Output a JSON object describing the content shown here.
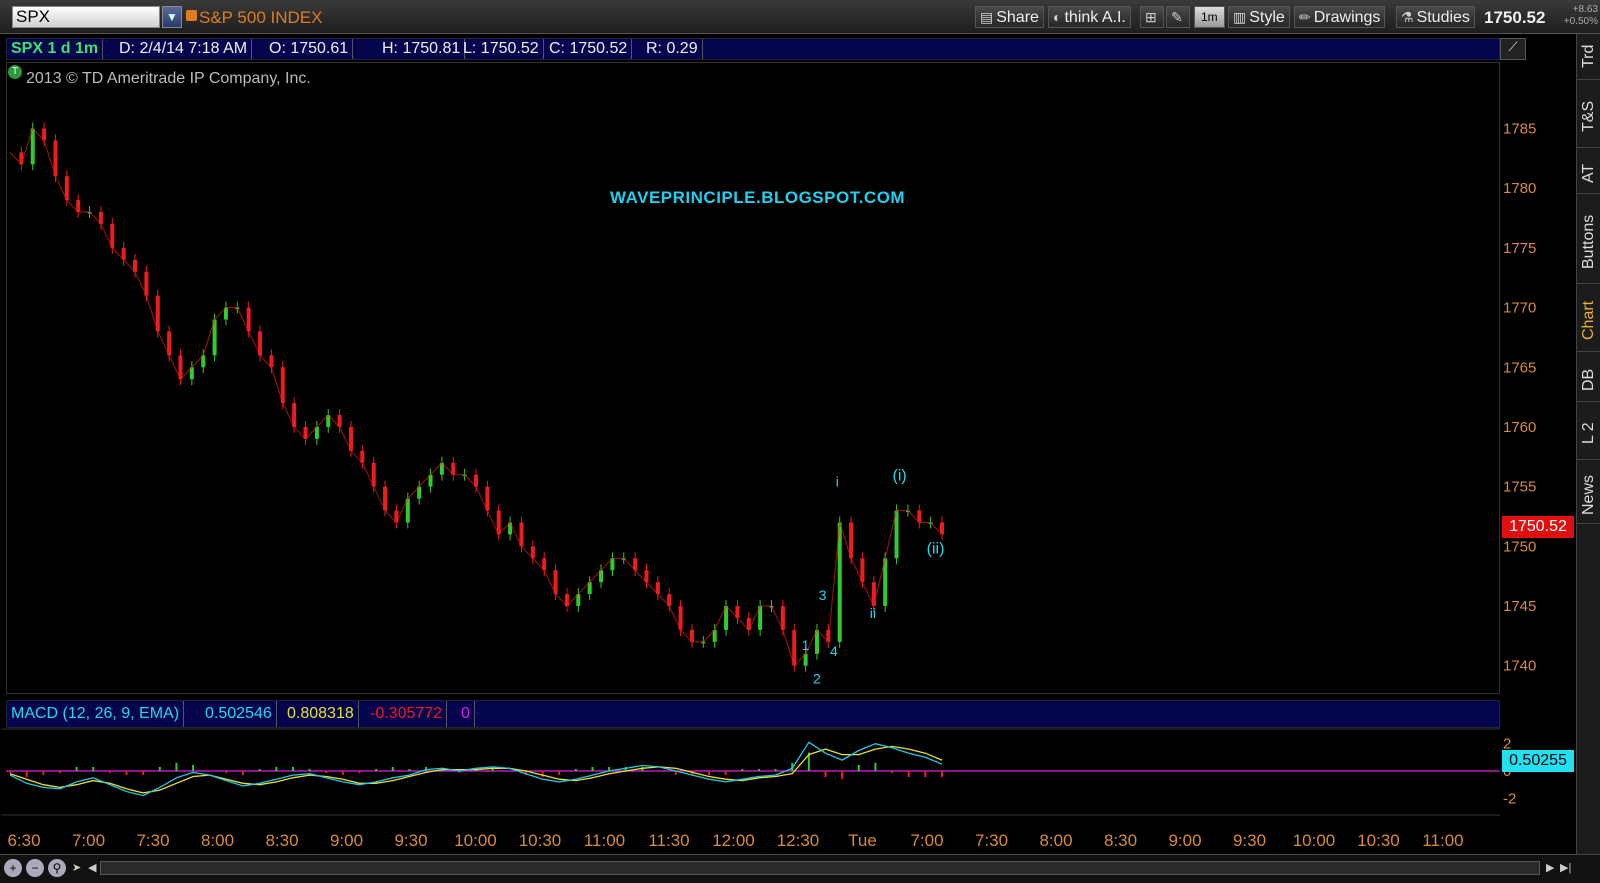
{
  "toolbar": {
    "symbol": "SPX",
    "index_name": "S&P 500 INDEX",
    "buttons": {
      "share": "Share",
      "think_ai": "think A.I.",
      "timeframe": "1m",
      "style": "Style",
      "drawings": "Drawings",
      "studies": "Studies"
    },
    "last_price": "1750.52",
    "change": "+8.63",
    "change_pct": "+0.50%"
  },
  "infobar": {
    "symbol_period": "SPX 1 d 1m",
    "date": "D: 2/4/14 7:18 AM",
    "open": "O: 1750.61",
    "high": "H: 1750.81",
    "low": "L: 1750.52",
    "close": "C: 1750.52",
    "range": "R: 0.29"
  },
  "copyright": "2013 © TD Ameritrade IP Company, Inc.",
  "watermark": "WAVEPRINCIPLE.BLOGSPOT.COM",
  "price_tag": "1750.52",
  "macd": {
    "title": "MACD (12, 26, 9, EMA)",
    "value": "0.502546",
    "avg": "0.808318",
    "diff": "-0.305772",
    "zero": "0",
    "tag": "0.50255"
  },
  "colors": {
    "up": "#2ecc2e",
    "down": "#ee1c1c",
    "axis_label": "#d98a3a",
    "wave_label": "#22d8f0",
    "macd_line": "#22c8e8",
    "signal_line": "#e8e030",
    "zero_line": "#e020e0"
  },
  "side_tabs": [
    "Trd",
    "T&S",
    "AT",
    "Buttons",
    "Chart",
    "DB",
    "L 2",
    "News"
  ],
  "chart_data": {
    "type": "line",
    "y_ticks": [
      1740,
      1745,
      1750,
      1755,
      1760,
      1765,
      1770,
      1775,
      1780,
      1785
    ],
    "ylim": [
      1737.8,
      1790.4
    ],
    "x_ticks": [
      "6:30",
      "7:00",
      "7:30",
      "8:00",
      "8:30",
      "9:00",
      "9:30",
      "10:00",
      "10:30",
      "11:00",
      "11:30",
      "12:00",
      "12:30",
      "Tue",
      "7:00",
      "7:30",
      "8:00",
      "8:30",
      "9:00",
      "9:30",
      "10:00",
      "10:30",
      "11:00"
    ],
    "series": [
      {
        "values": [
          1783,
          1782,
          1785,
          1784,
          1781,
          1779,
          1778,
          1778,
          1777,
          1775,
          1774,
          1773,
          1771,
          1768,
          1766,
          1764,
          1765,
          1766,
          1769,
          1770,
          1770,
          1768,
          1766,
          1765,
          1762,
          1760,
          1759,
          1760,
          1761,
          1760,
          1758,
          1757,
          1755,
          1753,
          1752,
          1754,
          1755,
          1756,
          1757,
          1756,
          1756,
          1755,
          1753,
          1751,
          1752,
          1750,
          1749,
          1748,
          1746,
          1745,
          1746,
          1747,
          1748,
          1749,
          1749,
          1748,
          1747,
          1746,
          1745,
          1743,
          1742,
          1742,
          1743,
          1745,
          1744,
          1743,
          1745,
          1745,
          1743,
          1740,
          1741,
          1743,
          1742,
          1752,
          1749,
          1747,
          1745,
          1749,
          1753,
          1753,
          1752,
          1752,
          1751
        ]
      }
    ],
    "macd": [
      -0.3,
      -0.9,
      -1.2,
      -1.3,
      -0.8,
      -0.5,
      -1.0,
      -1.5,
      -1.8,
      -1.2,
      -0.5,
      -0.1,
      -0.3,
      -0.7,
      -1.1,
      -0.9,
      -0.6,
      -0.3,
      -0.2,
      -0.5,
      -0.8,
      -1.0,
      -0.8,
      -0.5,
      -0.3,
      0.1,
      0.2,
      0.0,
      0.2,
      0.3,
      0.2,
      -0.2,
      -0.6,
      -0.8,
      -0.6,
      -0.3,
      0.0,
      0.2,
      0.4,
      0.3,
      0.0,
      -0.3,
      -0.6,
      -0.8,
      -0.6,
      -0.4,
      -0.3,
      0.2,
      2.1,
      1.3,
      0.8,
      1.5,
      2.0,
      1.7,
      1.3,
      1.0,
      0.5
    ],
    "signal": [
      -0.2,
      -0.6,
      -1.0,
      -1.2,
      -1.0,
      -0.7,
      -0.9,
      -1.3,
      -1.6,
      -1.4,
      -0.9,
      -0.4,
      -0.3,
      -0.6,
      -0.9,
      -1.0,
      -0.8,
      -0.5,
      -0.3,
      -0.4,
      -0.6,
      -0.9,
      -0.9,
      -0.7,
      -0.4,
      -0.1,
      0.1,
      0.1,
      0.1,
      0.2,
      0.2,
      0.0,
      -0.3,
      -0.6,
      -0.7,
      -0.5,
      -0.2,
      0.0,
      0.2,
      0.3,
      0.2,
      -0.1,
      -0.4,
      -0.6,
      -0.7,
      -0.5,
      -0.4,
      -0.2,
      1.2,
      1.6,
      1.2,
      1.2,
      1.6,
      1.8,
      1.6,
      1.3,
      0.8
    ],
    "macd_ticks": [
      "2",
      "0",
      "-2"
    ],
    "macd_ylim": [
      -3,
      3
    ],
    "wave_labels": [
      {
        "text": "i",
        "x_index": 73,
        "y": 1755
      },
      {
        "text": "ii",
        "x_index": 76,
        "y": 1744
      },
      {
        "text": "(i)",
        "x_index": 78,
        "y": 1755.5
      },
      {
        "text": "(ii)",
        "x_index": 81,
        "y": 1749.4
      },
      {
        "text": "1",
        "x_index": 70,
        "y": 1741.3
      },
      {
        "text": "2",
        "x_index": 71,
        "y": 1738.5
      },
      {
        "text": "3",
        "x_index": 71.5,
        "y": 1745.5
      },
      {
        "text": "4",
        "x_index": 72.5,
        "y": 1740.8
      }
    ]
  }
}
